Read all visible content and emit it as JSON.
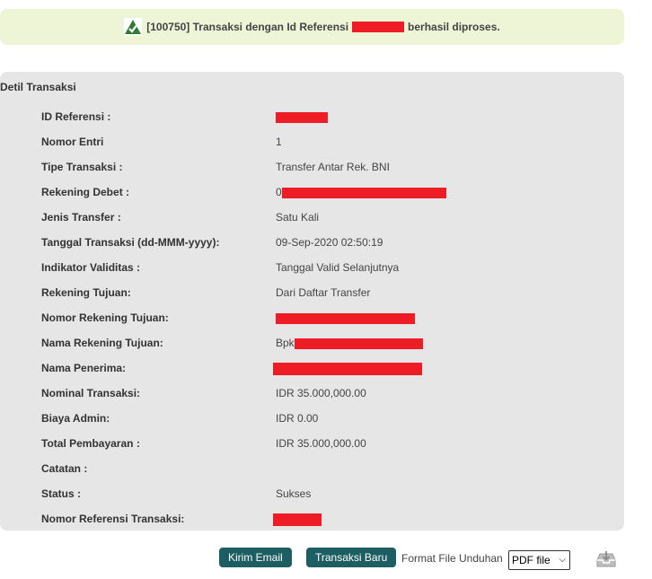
{
  "banner": {
    "icon": "check-icon",
    "text_before": "[100750] Transaksi dengan Id Referensi",
    "text_after": "berhasil diproses."
  },
  "panel": {
    "title": "Detil Transaksi",
    "rows": [
      {
        "label": "ID Referensi :",
        "value": ""
      },
      {
        "label": "Nomor Entri",
        "value": "1"
      },
      {
        "label": "Tipe Transaksi :",
        "value": "Transfer Antar Rek. BNI"
      },
      {
        "label": "Rekening Debet :",
        "value": "0"
      },
      {
        "label": "Jenis Transfer :",
        "value": "Satu Kali"
      },
      {
        "label": "Tanggal Transaksi (dd-MMM-yyyy):",
        "value": "09-Sep-2020 02:50:19"
      },
      {
        "label": "Indikator Validitas :",
        "value": "Tanggal Valid Selanjutnya"
      },
      {
        "label": "Rekening Tujuan:",
        "value": "Dari Daftar Transfer"
      },
      {
        "label": "Nomor Rekening Tujuan:",
        "value": ""
      },
      {
        "label": "Nama Rekening Tujuan:",
        "value": "Bpk"
      },
      {
        "label": "Nama Penerima:",
        "value": ""
      },
      {
        "label": "Nominal Transaksi:",
        "value": "IDR 35.000,000.00"
      },
      {
        "label": "Biaya Admin:",
        "value": "IDR 0.00"
      },
      {
        "label": "Total Pembayaran :",
        "value": "IDR 35.000,000.00"
      },
      {
        "label": "Catatan :",
        "value": ""
      },
      {
        "label": "Status :",
        "value": "Sukses"
      },
      {
        "label": "Nomor Referensi Transaksi:",
        "value": ""
      }
    ]
  },
  "footer": {
    "kirim_email": "Kirim Email",
    "transaksi_baru": "Transaksi Baru",
    "format_label": "Format File Unduhan",
    "format_selected": "PDF file",
    "download_icon": "download-tray-icon"
  },
  "colors": {
    "banner_bg": "#eef5d6",
    "panel_bg": "#e6e6e6",
    "button_bg": "#1d5e62",
    "redaction": "#ee1c25"
  }
}
